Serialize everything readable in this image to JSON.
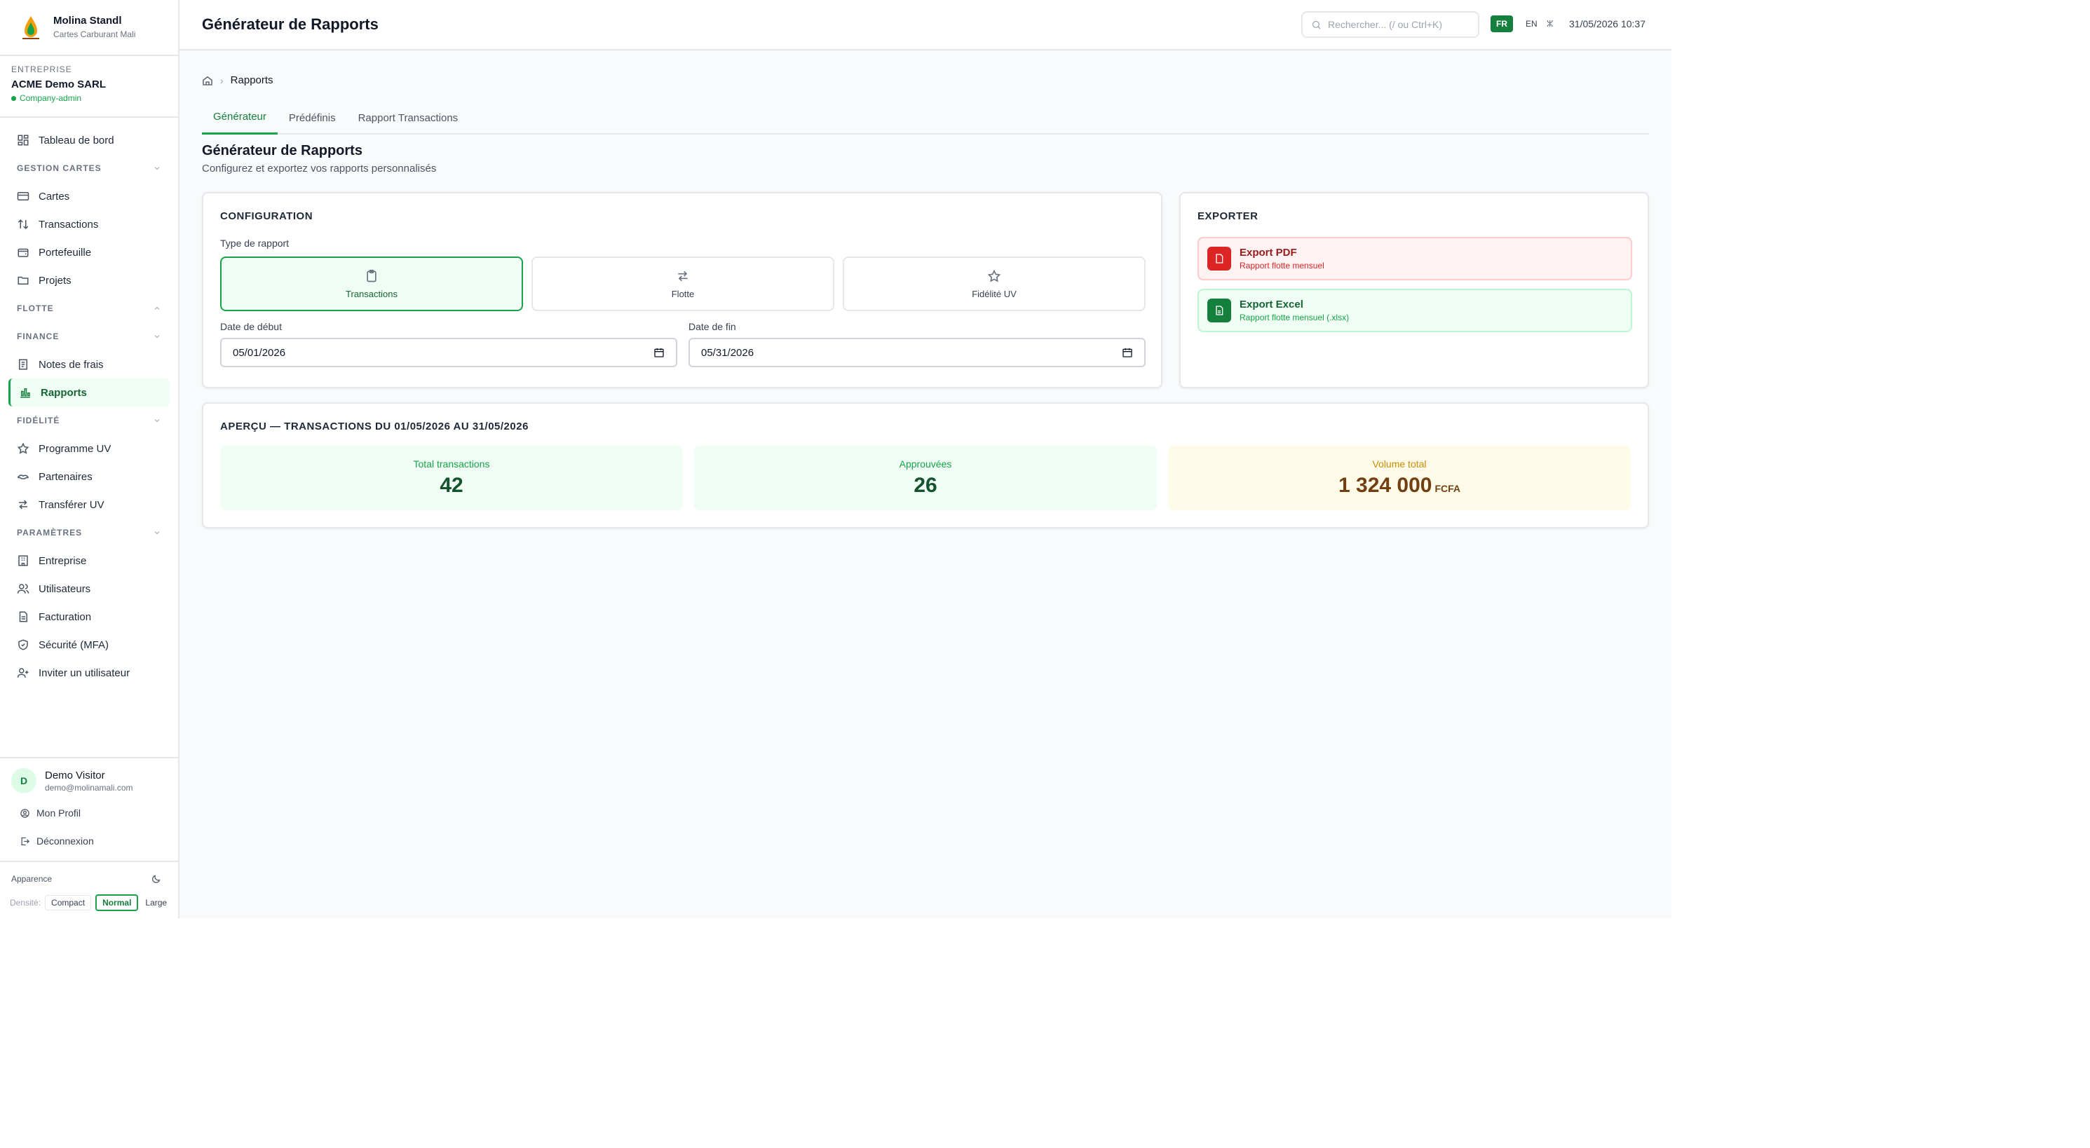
{
  "brand": {
    "name": "Molina Standl",
    "subtitle": "Cartes Carburant Mali"
  },
  "company": {
    "label": "ENTREPRISE",
    "name": "ACME Demo SARL",
    "role": "Company-admin"
  },
  "sidebar": {
    "dashboard": "Tableau de bord",
    "sections": {
      "cards": "GESTION CARTES",
      "fleet": "FLOTTE",
      "finance": "FINANCE",
      "loyalty": "FIDÉLITÉ",
      "settings": "PARAMÈTRES"
    },
    "items": {
      "cards": "Cartes",
      "transactions": "Transactions",
      "wallet": "Portefeuille",
      "projects": "Projets",
      "expenses": "Notes de frais",
      "reports": "Rapports",
      "uv_program": "Programme UV",
      "partners": "Partenaires",
      "transfer_uv": "Transférer UV",
      "company": "Entreprise",
      "users": "Utilisateurs",
      "billing": "Facturation",
      "security": "Sécurité (MFA)",
      "invite": "Inviter un utilisateur"
    }
  },
  "user": {
    "initial": "D",
    "name": "Demo Visitor",
    "email": "demo@molinamali.com",
    "profile": "Mon Profil",
    "logout": "Déconnexion"
  },
  "appearance": {
    "label": "Apparence",
    "density_label": "Densité:",
    "compact": "Compact",
    "normal": "Normal",
    "large": "Large"
  },
  "header": {
    "title": "Générateur de Rapports",
    "search_placeholder": "Rechercher... (/ ou Ctrl+K)",
    "lang_fr": "FR",
    "lang_en": "EN",
    "lang_other": "ⵣ",
    "datetime": "31/05/2026 10:37"
  },
  "breadcrumb": {
    "current": "Rapports"
  },
  "tabs": [
    "Générateur",
    "Prédéfinis",
    "Rapport Transactions"
  ],
  "section": {
    "title": "Générateur de Rapports",
    "subtitle": "Configurez et exportez vos rapports personnalisés"
  },
  "config": {
    "title": "CONFIGURATION",
    "type_label": "Type de rapport",
    "types": [
      "Transactions",
      "Flotte",
      "Fidélité UV"
    ],
    "start_label": "Date de début",
    "start_value": "05/01/2026",
    "end_label": "Date de fin",
    "end_value": "05/31/2026"
  },
  "export": {
    "title": "EXPORTER",
    "pdf": {
      "name": "Export PDF",
      "sub": "Rapport flotte mensuel"
    },
    "excel": {
      "name": "Export Excel",
      "sub": "Rapport flotte mensuel (.xlsx)"
    }
  },
  "preview": {
    "title": "APERÇU — TRANSACTIONS DU 01/05/2026 AU 31/05/2026",
    "stats": [
      {
        "label": "Total transactions",
        "value": "42"
      },
      {
        "label": "Approuvées",
        "value": "26"
      },
      {
        "label": "Volume total",
        "value": "1 324 000",
        "unit": "FCFA"
      }
    ]
  },
  "colors": {
    "accent": "#15803d",
    "accent_light": "#f0fdf4",
    "danger": "#dc2626",
    "warning": "#ca8a04"
  }
}
